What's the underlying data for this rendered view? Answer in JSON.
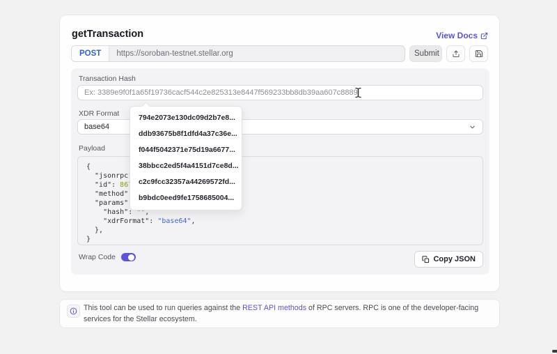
{
  "header": {
    "title": "getTransaction",
    "view_docs_label": "View Docs"
  },
  "request": {
    "method": "POST",
    "url": "https://soroban-testnet.stellar.org",
    "submit_label": "Submit"
  },
  "form": {
    "hash_label": "Transaction Hash",
    "hash_value": "",
    "hash_placeholder": "Ex: 3389e9f0f1a65f19736cacf544c2e825313e8447f569233bb8db39aa607c8889",
    "xdr_format_label": "XDR Format",
    "xdr_format_value": "base64",
    "payload_label": "Payload"
  },
  "suggestions": [
    "794e2073e130dc09d2b7e8...",
    "ddb93675b8f1dfd4a37c36e...",
    "f044f5042371e75d19a6677...",
    "38bbcc2ed5f4a4151d7ce8d...",
    "c2c9fcc32357a44269572fd...",
    "b9bdc0eed9fe1758685004..."
  ],
  "payload": {
    "lines": [
      [
        {
          "t": "{",
          "c": "plain"
        }
      ],
      [
        {
          "t": "  \"jsonrpc\": ",
          "c": "plain"
        }
      ],
      [
        {
          "t": "  \"id\": ",
          "c": "plain"
        },
        {
          "t": "86753",
          "c": "number"
        }
      ],
      [
        {
          "t": "  \"method\": \"",
          "c": "plain"
        }
      ],
      [
        {
          "t": "  \"params\": {",
          "c": "plain"
        }
      ],
      [
        {
          "t": "    \"hash\": \"\",",
          "c": "plain"
        }
      ],
      [
        {
          "t": "    \"xdrFormat\": ",
          "c": "plain"
        },
        {
          "t": "\"base64\"",
          "c": "string"
        },
        {
          "t": ",",
          "c": "plain"
        }
      ],
      [
        {
          "t": "  },",
          "c": "plain"
        }
      ],
      [
        {
          "t": "}",
          "c": "plain"
        }
      ]
    ]
  },
  "code_footer": {
    "wrap_label": "Wrap Code",
    "wrap_on": true,
    "copy_label": "Copy JSON"
  },
  "note": {
    "prefix": "This tool can be used to run queries against the ",
    "link_label": "REST API methods",
    "suffix": " of RPC servers. RPC is one of the developer-facing services for the Stellar ecosystem."
  },
  "colors": {
    "accent_indigo": "#5b51e0",
    "method_blue": "#3062d4",
    "json_number": "#8f9d0a",
    "json_string": "#3a66d9",
    "toggle_on": "#5d54dc",
    "page_bg": "#f2f2f3"
  }
}
